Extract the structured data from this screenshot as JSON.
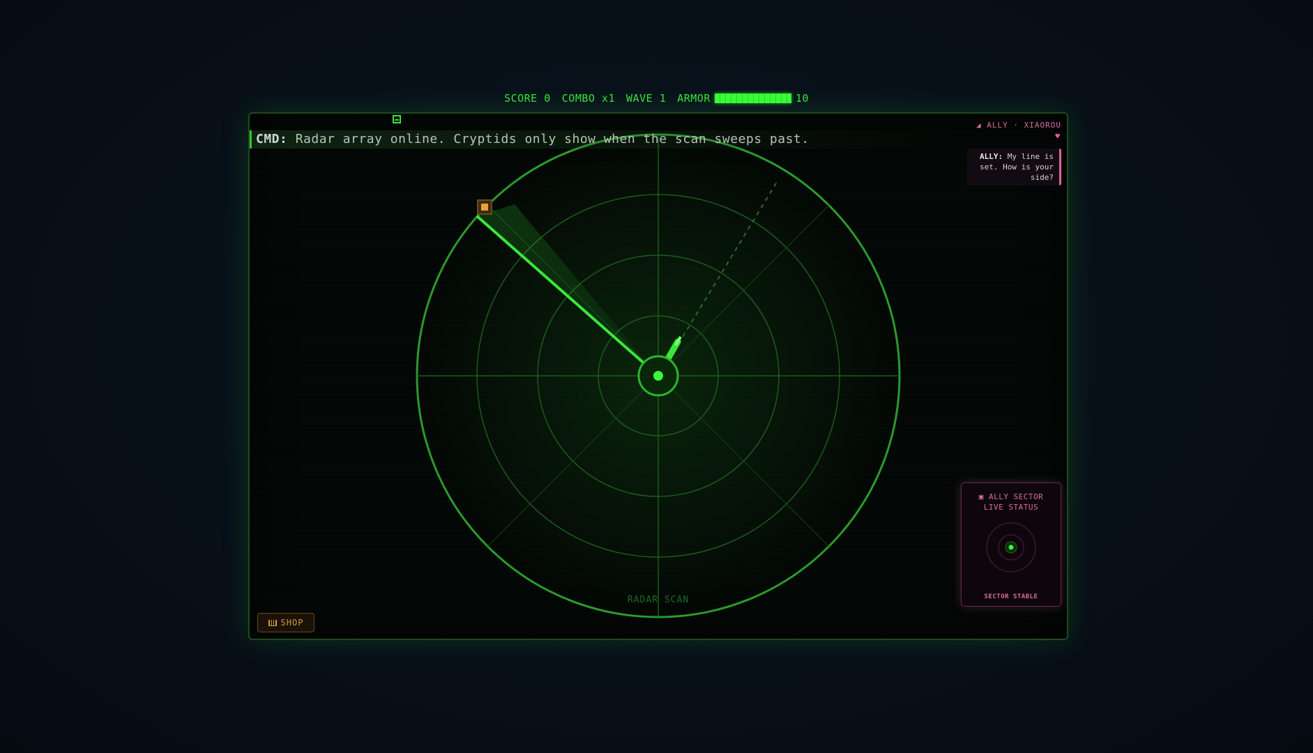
{
  "hud": {
    "score_label": "SCORE",
    "score": "0",
    "combo_label": "COMBO",
    "combo": "x1",
    "wave_label": "WAVE",
    "wave": "1",
    "armor_label": "ARMOR",
    "armor": "10"
  },
  "cmd": {
    "tag": "CMD:",
    "message": " Radar array online. Cryptids only show when the scan sweeps past."
  },
  "ally": {
    "header": "◢ ALLY · XIAOROU",
    "heart": "♥",
    "name": "ALLY:",
    "message": " My line is set. How is your side?",
    "panel_title_line1": "▣ ALLY SECTOR",
    "panel_title_line2": "LIVE STATUS",
    "panel_status": "SECTOR STABLE"
  },
  "radar": {
    "label": "RADAR SCAN"
  },
  "shop": {
    "icon": "cart-icon",
    "label": "SHOP"
  },
  "colors": {
    "radar_green": "#39e639",
    "ally_pink": "#d86ea0",
    "shop_orange": "#d89a40",
    "blip_orange": "#e8a030"
  }
}
